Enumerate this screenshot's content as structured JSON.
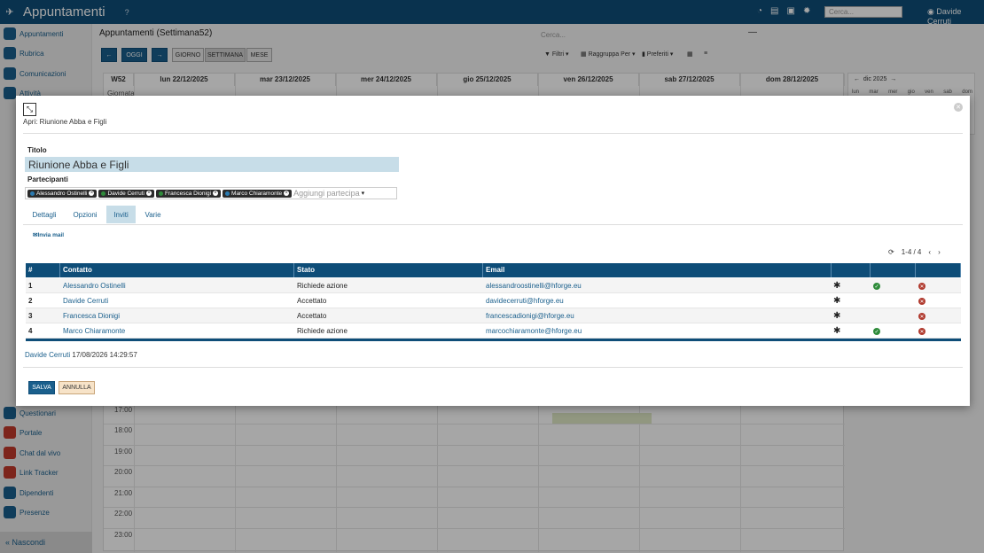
{
  "app": {
    "title": "Appuntamenti",
    "help": "?",
    "search_placeholder": "Cerca...",
    "user": "Davide Cerruti"
  },
  "sidebar": {
    "items": [
      "Appuntamenti",
      "Rubrica",
      "Comunicazioni",
      "Attività",
      "Questionari",
      "Portale",
      "Chat dal vivo",
      "Link Tracker",
      "Dipendenti",
      "Presenze"
    ],
    "collapse": "Nascondi"
  },
  "calendar": {
    "title": "Appuntamenti (Settimana52)",
    "search_placeholder": "Cerca...",
    "nav": {
      "prev": "←",
      "today": "OGGI",
      "next": "→"
    },
    "views": [
      "GIORNO",
      "SETTIMANA",
      "MESE"
    ],
    "toolbar": {
      "filter": "Filtri",
      "group": "Raggruppa Per",
      "favorites": "Preferiti"
    },
    "week_label": "W52",
    "days": [
      "lun 22/12/2025",
      "mar 23/12/2025",
      "mer 24/12/2025",
      "gio 25/12/2025",
      "ven 26/12/2025",
      "sab 27/12/2025",
      "dom 28/12/2025"
    ],
    "allday_label": "Giornata",
    "hours": [
      "17:00",
      "18:00",
      "19:00",
      "20:00",
      "21:00",
      "22:00",
      "23:00"
    ],
    "mini": {
      "month": "dic 2025",
      "weekdays": [
        "lun",
        "mar",
        "mer",
        "gio",
        "ven",
        "sab",
        "dom"
      ]
    }
  },
  "modal": {
    "open_label": "Apri: Riunione Abba e Figli",
    "title_label": "Titolo",
    "title_value": "Riunione Abba e Figli",
    "participants_label": "Partecipanti",
    "participants": [
      "Alessandro Ostinelli",
      "Davide Cerruti",
      "Francesca Dionigi",
      "Marco Chiaramonte"
    ],
    "add_participant": "Aggiungi partecipa",
    "tabs": [
      "Dettagli",
      "Opzioni",
      "Inviti",
      "Varie"
    ],
    "active_tab": "Inviti",
    "send_mail": "Invia mail",
    "pager": "1-4 / 4",
    "columns": [
      "#",
      "Contatto",
      "Stato",
      "Email"
    ],
    "rows": [
      {
        "n": "1",
        "contact": "Alessandro Ostinelli",
        "status": "Richiede azione",
        "email": "alessandroostinelli@hforge.eu",
        "accept": true
      },
      {
        "n": "2",
        "contact": "Davide Cerruti",
        "status": "Accettato",
        "email": "davidecerruti@hforge.eu",
        "accept": false
      },
      {
        "n": "3",
        "contact": "Francesca Dionigi",
        "status": "Accettato",
        "email": "francescadionigi@hforge.eu",
        "accept": false
      },
      {
        "n": "4",
        "contact": "Marco Chiaramonte",
        "status": "Richiede azione",
        "email": "marcochiaramonte@hforge.eu",
        "accept": true
      }
    ],
    "audit_user": "Davide Cerruti",
    "audit_time": "17/08/2026 14:29:57",
    "save": "SALVA",
    "cancel": "ANNULLA"
  },
  "colors": {
    "primary": "#0e4d78",
    "accent": "#1a5f8c",
    "tab_active": "#c7dde8",
    "accept": "#2e8b3a",
    "reject": "#b03a2e"
  }
}
